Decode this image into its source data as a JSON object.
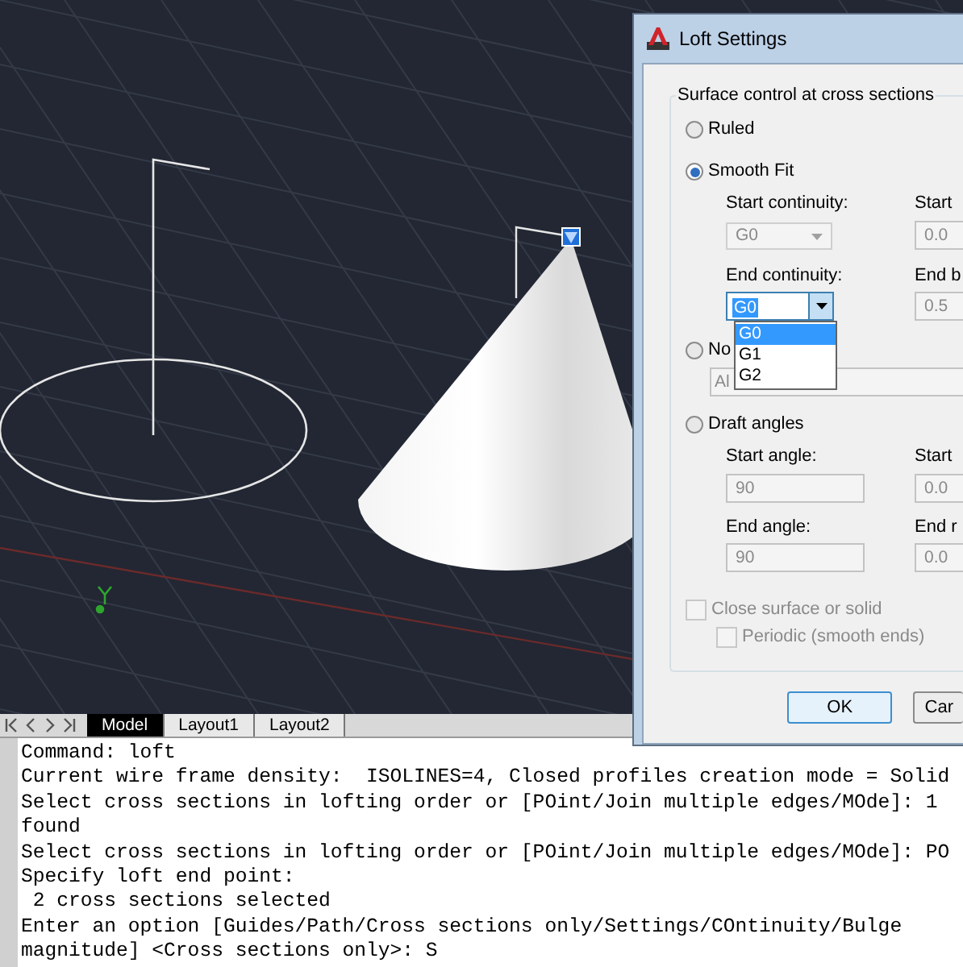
{
  "drawing_tabs": [
    {
      "label": "Model",
      "selected": true
    },
    {
      "label": "Layout1",
      "selected": false
    },
    {
      "label": "Layout2",
      "selected": false
    }
  ],
  "command_lines": [
    "Command: loft",
    "Current wire frame density:  ISOLINES=4, Closed profiles creation mode = Solid",
    "Select cross sections in lofting order or [POint/Join multiple edges/MOde]: 1",
    "found",
    "Select cross sections in lofting order or [POint/Join multiple edges/MOde]: PO",
    "Specify loft end point:",
    " 2 cross sections selected",
    "Enter an option [Guides/Path/Cross sections only/Settings/COntinuity/Bulge",
    "magnitude] <Cross sections only>: S"
  ],
  "dialog": {
    "title": "Loft Settings",
    "group_label": "Surface control at cross sections",
    "ruled": {
      "label": "Ruled",
      "selected": false
    },
    "smooth_fit": {
      "label": "Smooth Fit",
      "selected": true,
      "start_continuity": {
        "label": "Start continuity:",
        "value": "G0",
        "disabled": true
      },
      "start_side_label": "Start",
      "start_side_value": "0.0",
      "end_continuity": {
        "label": "End continuity:",
        "value": "G0",
        "expanded": true,
        "options": [
          {
            "label": "G0",
            "selected": true
          },
          {
            "label": "G1",
            "selected": false
          },
          {
            "label": "G2",
            "selected": false
          }
        ]
      },
      "end_side_label": "End b",
      "end_side_value": "0.5"
    },
    "normals": {
      "label": "No",
      "selected": false,
      "value": "Al"
    },
    "draft_angles": {
      "label": "Draft angles",
      "selected": false,
      "start_angle": {
        "label": "Start angle:",
        "value": "90"
      },
      "start_side_label": "Start",
      "start_side_value": "0.0",
      "end_angle": {
        "label": "End angle:",
        "value": "90"
      },
      "end_side_label": "End r",
      "end_side_value": "0.0"
    },
    "close_surface": {
      "label": "Close surface or solid",
      "checked": false,
      "disabled": true,
      "children": [
        {
          "label": "Periodic (smooth ends)",
          "checked": false,
          "disabled": true
        }
      ]
    },
    "buttons": [
      {
        "label": "OK",
        "default": true
      },
      {
        "label": "Car",
        "default": false
      }
    ]
  }
}
